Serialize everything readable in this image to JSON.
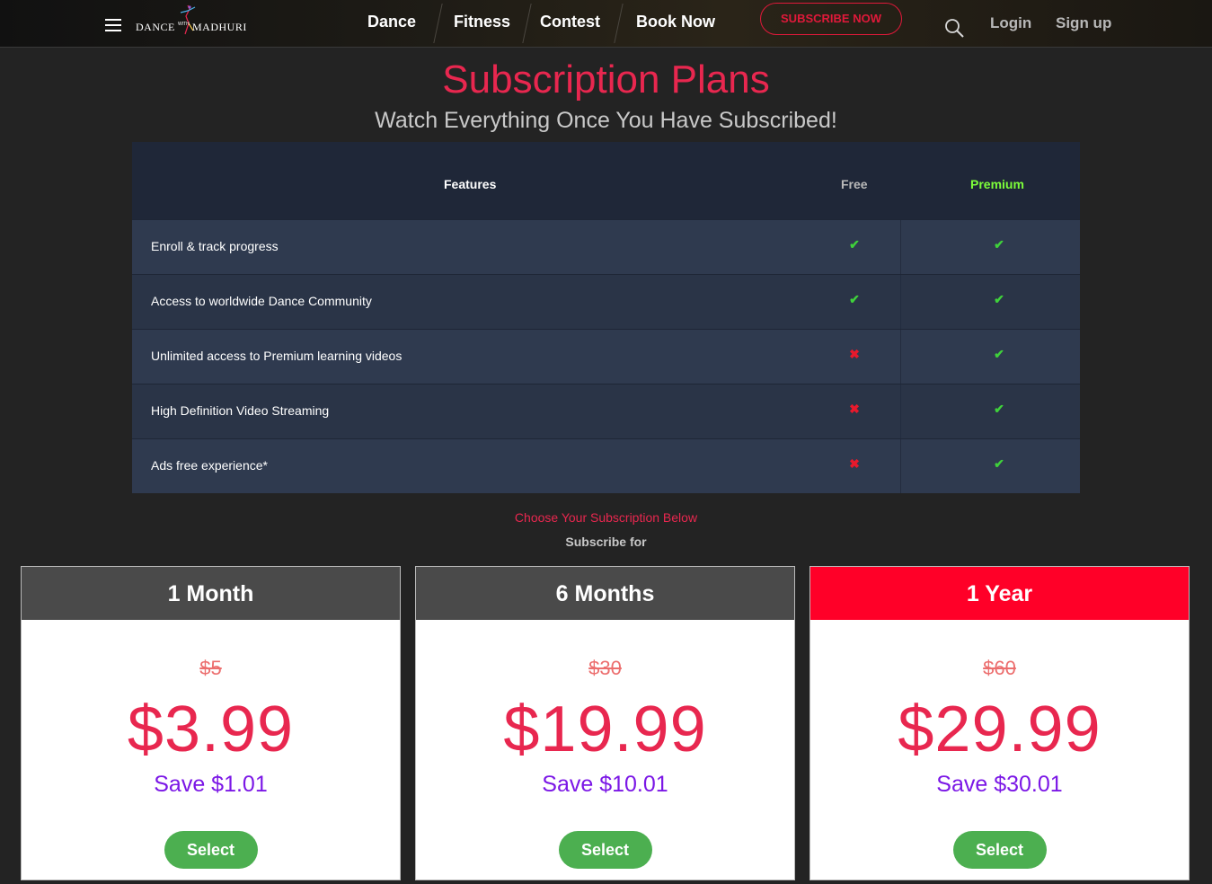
{
  "header": {
    "logo": {
      "word1": "DANCE",
      "word2": "MADHURI",
      "with": "WITH"
    },
    "nav": [
      "Dance",
      "Fitness",
      "Contest",
      "Book Now"
    ],
    "subscribe_label": "SUBSCRIBE NOW",
    "login_label": "Login",
    "signup_label": "Sign up"
  },
  "page": {
    "title": "Subscription Plans",
    "subtitle": "Watch Everything Once You Have Subscribed!"
  },
  "features_table": {
    "headers": {
      "feature": "Features",
      "free": "Free",
      "premium": "Premium"
    },
    "rows": [
      {
        "label": "Enroll & track progress",
        "free": true,
        "premium": true
      },
      {
        "label": "Access to worldwide Dance Community",
        "free": true,
        "premium": true
      },
      {
        "label": "Unlimited access to Premium learning videos",
        "free": false,
        "premium": true
      },
      {
        "label": "High Definition Video Streaming",
        "free": false,
        "premium": true
      },
      {
        "label": "Ads free experience*",
        "free": false,
        "premium": true
      }
    ],
    "check_glyph": "✔",
    "cross_glyph": "✖"
  },
  "subscribe_section": {
    "choose_text": "Choose Your Subscription Below",
    "subscribe_for": "Subscribe for"
  },
  "plans": [
    {
      "name": "1 Month",
      "old_price": "$5",
      "price": "$3.99",
      "save": "Save $1.01",
      "select_label": "Select"
    },
    {
      "name": "6 Months",
      "old_price": "$30",
      "price": "$19.99",
      "save": "Save $10.01",
      "select_label": "Select"
    },
    {
      "name": "1 Year",
      "old_price": "$60",
      "price": "$29.99",
      "save": "Save $30.01",
      "select_label": "Select"
    }
  ],
  "colors": {
    "accent": "#e8274f",
    "premium_green": "#7dff3a",
    "check": "#3fd13b",
    "cross": "#e8192c",
    "best_plan": "#ff0028",
    "save_purple": "#7b17e6",
    "select_green": "#4caf50"
  }
}
